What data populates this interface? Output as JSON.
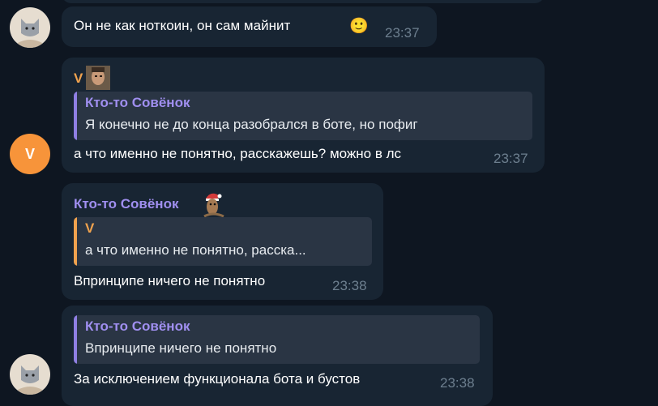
{
  "messages": [
    {
      "text": "Он не как ноткоин, он сам майнит",
      "emoji": "🙂",
      "time": "23:37"
    },
    {
      "sender": "V",
      "reply": {
        "name": "Кто-то Совёнок",
        "text": "Я конечно не до конца разобрался в боте, но пофиг"
      },
      "text": "а что именно не понятно, расскажешь? можно в лс",
      "time": "23:37",
      "avatar_letter": "V"
    },
    {
      "sender": "Кто-то Совёнок",
      "reply": {
        "name": "V",
        "text": "а что именно не понятно, расска..."
      },
      "text": "Впринципе ничего не понятно",
      "time": "23:38"
    },
    {
      "reply": {
        "name": "Кто-то Совёнок",
        "text": "Впринципе ничего не понятно"
      },
      "text": "За исключением функционала бота и бустов",
      "time": "23:38"
    }
  ],
  "colors": {
    "background": "#0e1621",
    "bubble": "#182533",
    "accent_purple": "#a08ff0",
    "accent_orange": "#f0a24e",
    "avatar_v": "#f7943a"
  }
}
